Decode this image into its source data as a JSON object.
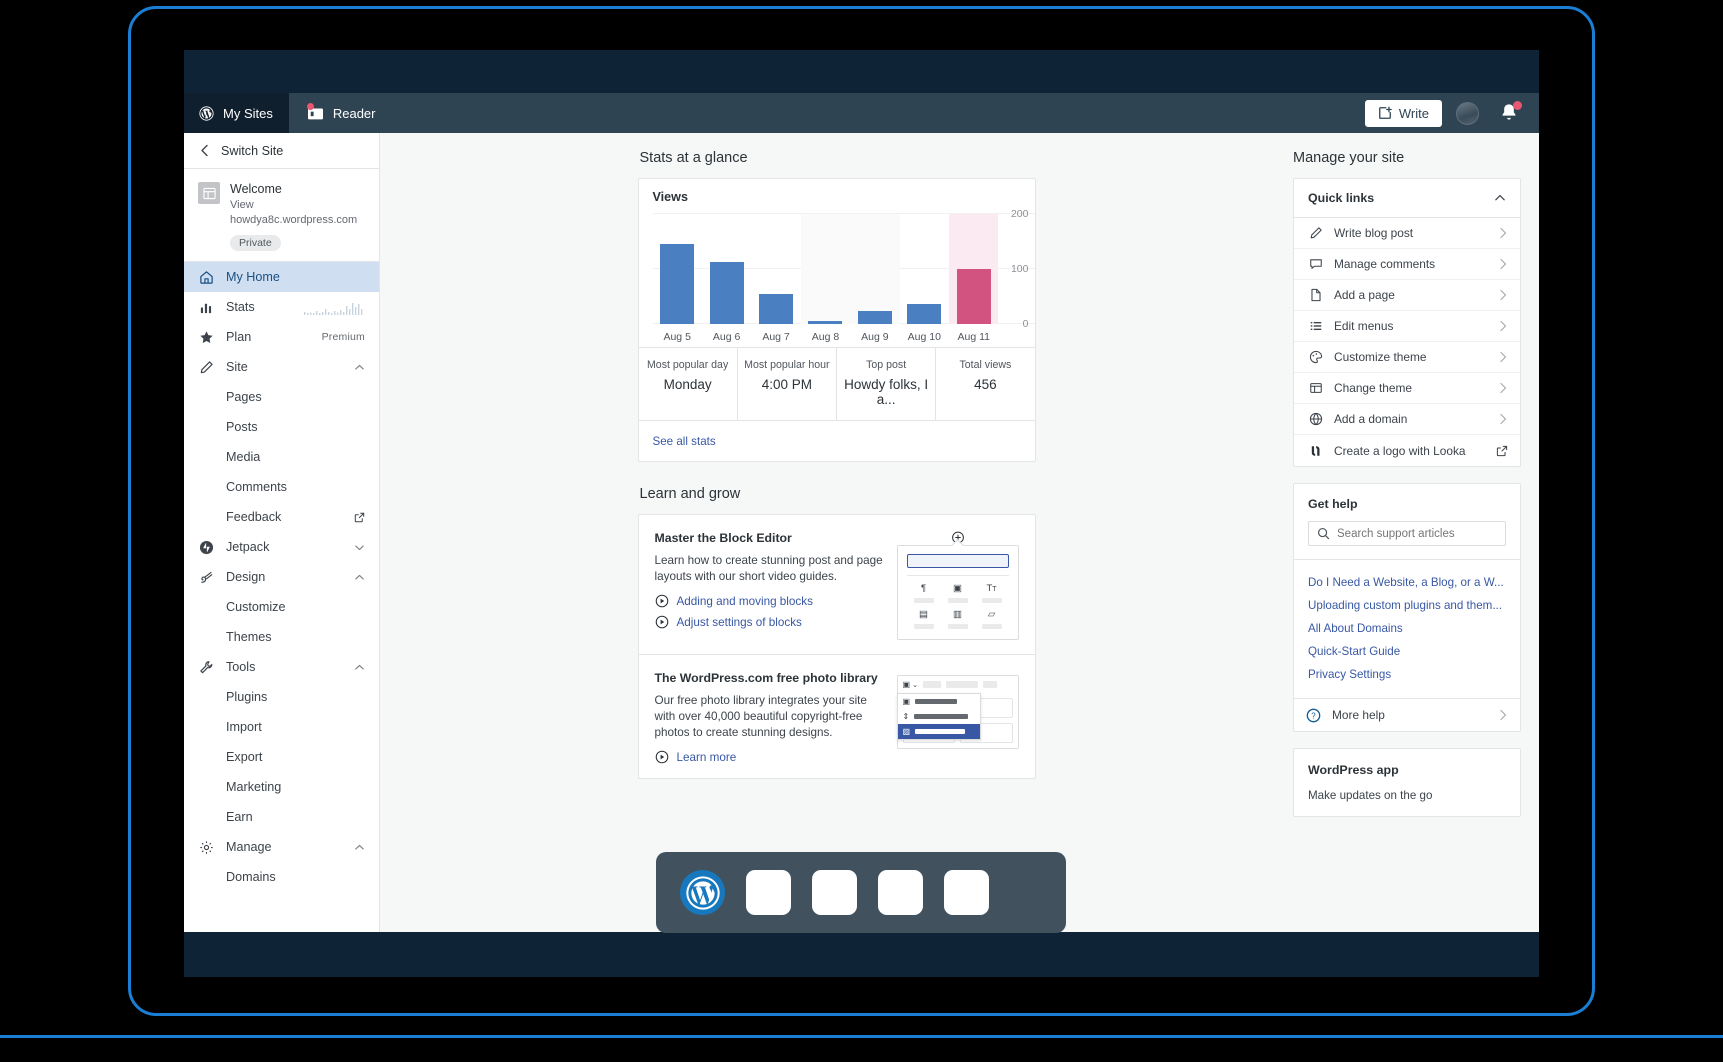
{
  "masterbar": {
    "my_sites": "My Sites",
    "reader": "Reader",
    "write": "Write"
  },
  "sidebar": {
    "switch_site": "Switch Site",
    "site": {
      "name": "Welcome",
      "url": "View howdya8c.wordpress.com",
      "badge": "Private"
    },
    "items": [
      {
        "label": "My Home",
        "icon": "home-icon",
        "active": true
      },
      {
        "label": "Stats",
        "icon": "stats-icon",
        "meta": "sparkline"
      },
      {
        "label": "Plan",
        "icon": "star-icon",
        "meta": "Premium"
      },
      {
        "label": "Site",
        "icon": "pencil-icon",
        "expanded": true
      },
      {
        "label": "Pages",
        "sub": true
      },
      {
        "label": "Posts",
        "sub": true
      },
      {
        "label": "Media",
        "sub": true
      },
      {
        "label": "Comments",
        "sub": true
      },
      {
        "label": "Feedback",
        "sub": true,
        "external": true
      },
      {
        "label": "Jetpack",
        "icon": "jetpack-icon",
        "expanded": false
      },
      {
        "label": "Design",
        "icon": "design-icon",
        "expanded": true
      },
      {
        "label": "Customize",
        "sub": true
      },
      {
        "label": "Themes",
        "sub": true
      },
      {
        "label": "Tools",
        "icon": "wrench-icon",
        "expanded": true
      },
      {
        "label": "Plugins",
        "sub": true
      },
      {
        "label": "Import",
        "sub": true
      },
      {
        "label": "Export",
        "sub": true
      },
      {
        "label": "Marketing",
        "sub": true
      },
      {
        "label": "Earn",
        "sub": true
      },
      {
        "label": "Manage",
        "icon": "gear-icon",
        "expanded": true
      },
      {
        "label": "Domains",
        "sub": true
      }
    ],
    "plan_meta": "Premium"
  },
  "main": {
    "stats_heading": "Stats at a glance",
    "views_card_title": "Views",
    "see_all_stats": "See all stats",
    "stat_cells": [
      {
        "key": "Most popular day",
        "value": "Monday"
      },
      {
        "key": "Most popular hour",
        "value": "4:00 PM"
      },
      {
        "key": "Top post",
        "value": "Howdy folks, I a..."
      },
      {
        "key": "Total views",
        "value": "456"
      }
    ],
    "learn_heading": "Learn and grow",
    "learn_cards": [
      {
        "title": "Master the Block Editor",
        "desc": "Learn how to create stunning post and page layouts with our short video guides.",
        "links": [
          "Adding and moving blocks",
          "Adjust settings of blocks"
        ]
      },
      {
        "title": "The WordPress.com free photo library",
        "desc": "Our free photo library integrates your site with over 40,000 beautiful copyright-free photos to create stunning designs.",
        "links": [
          "Learn more"
        ]
      }
    ]
  },
  "chart_data": {
    "type": "bar",
    "title": "Views",
    "categories": [
      "Aug 5",
      "Aug 6",
      "Aug 7",
      "Aug 8",
      "Aug 9",
      "Aug 10",
      "Aug 11"
    ],
    "values": [
      145,
      112,
      54,
      6,
      24,
      37,
      100
    ],
    "colors": [
      "#4a7fc1",
      "#4a7fc1",
      "#4a7fc1",
      "#4a7fc1",
      "#4a7fc1",
      "#4a7fc1",
      "#d2537f"
    ],
    "highlight_index": 6,
    "alt_band_indices": [
      3,
      4
    ],
    "ylim": [
      0,
      200
    ],
    "yticks": [
      0,
      100,
      200
    ],
    "ytick_labels": [
      "0",
      "100",
      "200"
    ],
    "xlabel": "",
    "ylabel": "",
    "grid": true,
    "legend": "none"
  },
  "right": {
    "heading": "Manage your site",
    "quick_links_title": "Quick links",
    "quick_links": [
      {
        "label": "Write blog post",
        "icon": "pencil-icon"
      },
      {
        "label": "Manage comments",
        "icon": "comment-icon"
      },
      {
        "label": "Add a page",
        "icon": "page-icon"
      },
      {
        "label": "Edit menus",
        "icon": "menu-icon"
      },
      {
        "label": "Customize theme",
        "icon": "palette-icon"
      },
      {
        "label": "Change theme",
        "icon": "layout-icon"
      },
      {
        "label": "Add a domain",
        "icon": "globe-icon"
      },
      {
        "label": "Create a logo with Looka",
        "icon": "looka-icon",
        "external": true
      }
    ],
    "get_help_title": "Get help",
    "search_placeholder": "Search support articles",
    "help_links": [
      "Do I Need a Website, a Blog, or a W...",
      "Uploading custom plugins and them...",
      "All About Domains",
      "Quick-Start Guide",
      "Privacy Settings"
    ],
    "more_help": "More help",
    "wp_app_title": "WordPress app",
    "wp_app_sub": "Make updates on the go"
  },
  "dock": {
    "apps": [
      "wordpress-icon",
      "app-1",
      "app-2",
      "app-3",
      "app-4"
    ]
  },
  "colors": {
    "accent": "#3858a5",
    "bar_blue": "#4a7fc1",
    "bar_pink": "#d2537f",
    "masterbar": "#2e4453",
    "frame_blue": "#1a7fd4"
  }
}
